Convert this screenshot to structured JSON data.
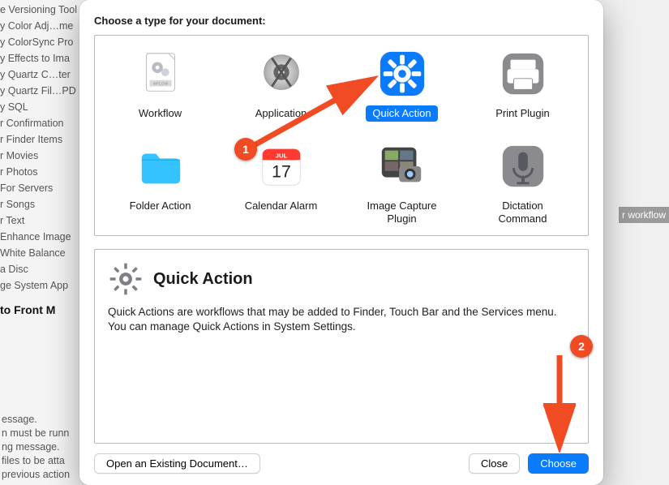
{
  "sidebar": {
    "items": [
      "e Versioning Tool",
      "y Color Adj…me",
      "y ColorSync Pro",
      "y Effects to Ima",
      "y Quartz C…ter",
      "y Quartz Fil…PD",
      "y SQL",
      "r Confirmation",
      "r Finder Items",
      "r Movies",
      "r Photos",
      "For Servers",
      "r Songs",
      "r Text",
      "Enhance Image",
      "White Balance",
      "a Disc",
      "ge System App"
    ],
    "bold_row": "to Front M"
  },
  "bg_hints": {
    "lines": [
      "essage.",
      "n must be runn",
      "ng message.",
      "files to be atta",
      "previous action"
    ],
    "right_chip": "r workflow"
  },
  "sheet": {
    "title": "Choose a type for your document:",
    "types": [
      {
        "label": "Workflow",
        "icon": "workflow-icon",
        "selected": false
      },
      {
        "label": "Application",
        "icon": "application-icon",
        "selected": false
      },
      {
        "label": "Quick Action",
        "icon": "quick-action-icon",
        "selected": true
      },
      {
        "label": "Print Plugin",
        "icon": "print-plugin-icon",
        "selected": false
      },
      {
        "label": "Folder Action",
        "icon": "folder-action-icon",
        "selected": false
      },
      {
        "label": "Calendar Alarm",
        "icon": "calendar-alarm-icon",
        "selected": false
      },
      {
        "label": "Image Capture\nPlugin",
        "icon": "image-capture-icon",
        "selected": false
      },
      {
        "label": "Dictation\nCommand",
        "icon": "dictation-icon",
        "selected": false
      }
    ],
    "calendar": {
      "month": "JUL",
      "day": "17"
    },
    "description": {
      "title": "Quick Action",
      "body": "Quick Actions are workflows that may be added to Finder, Touch Bar and the Services menu. You can manage Quick Actions in System Settings."
    },
    "buttons": {
      "open_existing": "Open an Existing Document…",
      "close": "Close",
      "choose": "Choose"
    }
  },
  "annotations": {
    "step1": "1",
    "step2": "2"
  },
  "colors": {
    "accent": "#0a7aff",
    "callout": "#f04b23"
  }
}
